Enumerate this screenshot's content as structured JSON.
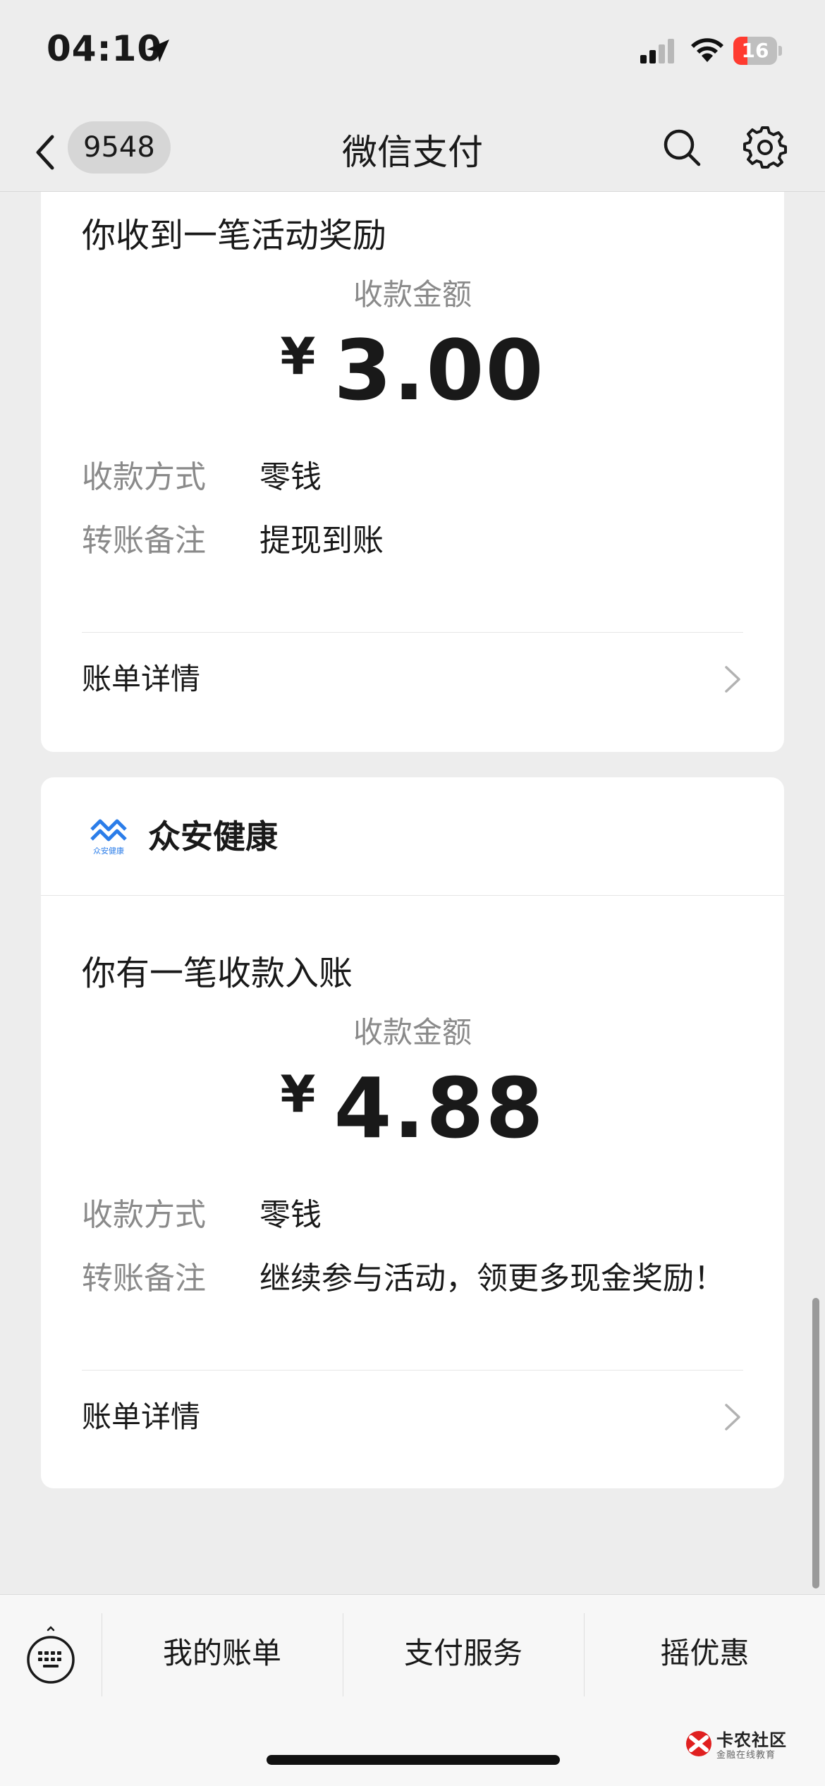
{
  "status_bar": {
    "time": "04:10",
    "battery": "16",
    "battery_level": 0.16,
    "icons": [
      "location-arrow-icon",
      "signal-icon",
      "wifi-icon",
      "battery-charging-icon"
    ]
  },
  "nav": {
    "unread_count": "9548",
    "title": "微信支付",
    "icons": [
      "back-chevron-icon",
      "search-icon",
      "gear-icon"
    ]
  },
  "messages": [
    {
      "title": "你收到一笔活动奖励",
      "amount_label": "收款金额",
      "currency": "¥",
      "amount": "3.00",
      "fields": [
        {
          "label": "收款方式",
          "value": "零钱"
        },
        {
          "label": "转账备注",
          "value": "提现到账"
        }
      ],
      "detail_label": "账单详情"
    },
    {
      "brand_name": "众安健康",
      "brand_logo_text": "众安健康",
      "title": "你有一笔收款入账",
      "amount_label": "收款金额",
      "currency": "¥",
      "amount": "4.88",
      "fields": [
        {
          "label": "收款方式",
          "value": "零钱"
        },
        {
          "label": "转账备注",
          "value": "继续参与活动，领更多现金奖励！"
        }
      ],
      "detail_label": "账单详情"
    }
  ],
  "bottom_menu": {
    "items": [
      "我的账单",
      "支付服务",
      "摇优惠"
    ],
    "keyboard_icon": "keyboard-icon"
  },
  "watermark": {
    "title": "卡农社区",
    "subtitle": "金融在线教育"
  },
  "colors": {
    "background": "#ededed",
    "card": "#ffffff",
    "muted_text": "#8a8a8a",
    "battery_low": "#ff3b30",
    "brand_blue": "#2b7de9"
  }
}
